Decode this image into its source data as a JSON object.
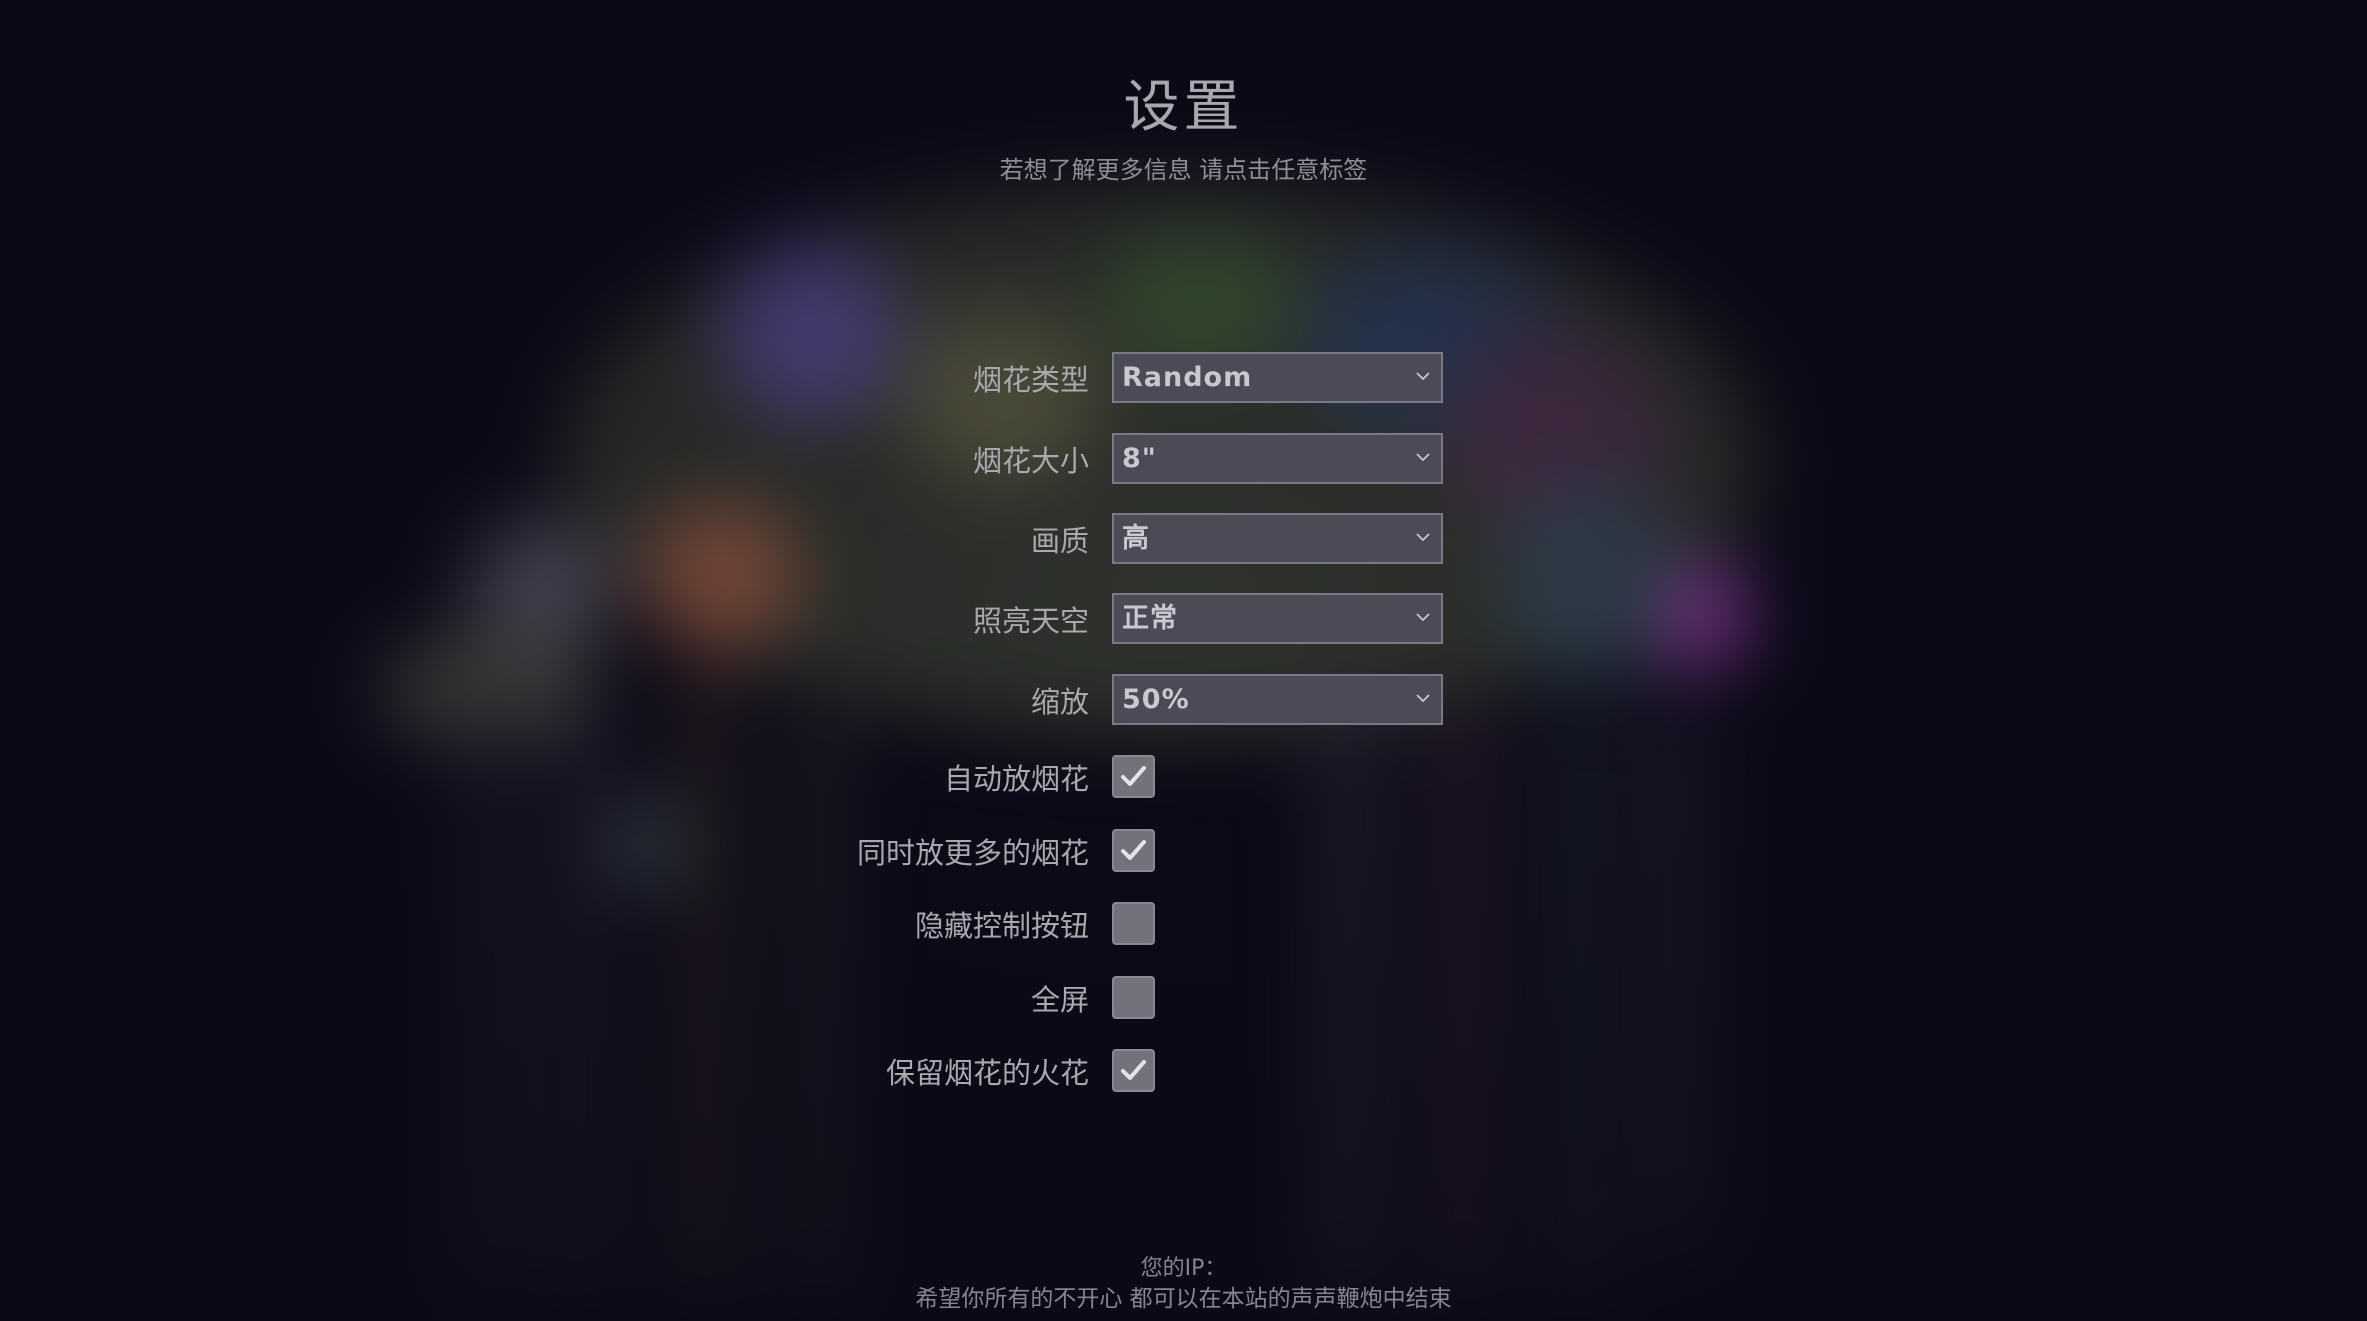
{
  "header": {
    "title": "设置",
    "subtitle": "若想了解更多信息 请点击任意标签"
  },
  "settings": {
    "shell_type": {
      "label": "烟花类型",
      "value": "Random"
    },
    "shell_size": {
      "label": "烟花大小",
      "value": "8\""
    },
    "quality": {
      "label": "画质",
      "value": "高"
    },
    "sky_lighting": {
      "label": "照亮天空",
      "value": "正常"
    },
    "scale": {
      "label": "缩放",
      "value": "50%"
    },
    "auto_launch": {
      "label": "自动放烟花",
      "checked": true
    },
    "finale_mode": {
      "label": "同时放更多的烟花",
      "checked": true
    },
    "hide_controls": {
      "label": "隐藏控制按钮",
      "checked": false
    },
    "fullscreen": {
      "label": "全屏",
      "checked": false
    },
    "long_exposure": {
      "label": "保留烟花的火花",
      "checked": true
    }
  },
  "footer": {
    "ip_label": "您的IP：",
    "message": "希望你所有的不开心 都可以在本站的声声鞭炮中结束"
  },
  "colors": {
    "background": "#0b0a17",
    "text": "#a9a8ae",
    "control_bg": "#4b4a57",
    "checkbox_bg": "#73727b"
  },
  "icons": {
    "select_arrow": "chevron-down-icon",
    "check": "checkmark-icon"
  }
}
